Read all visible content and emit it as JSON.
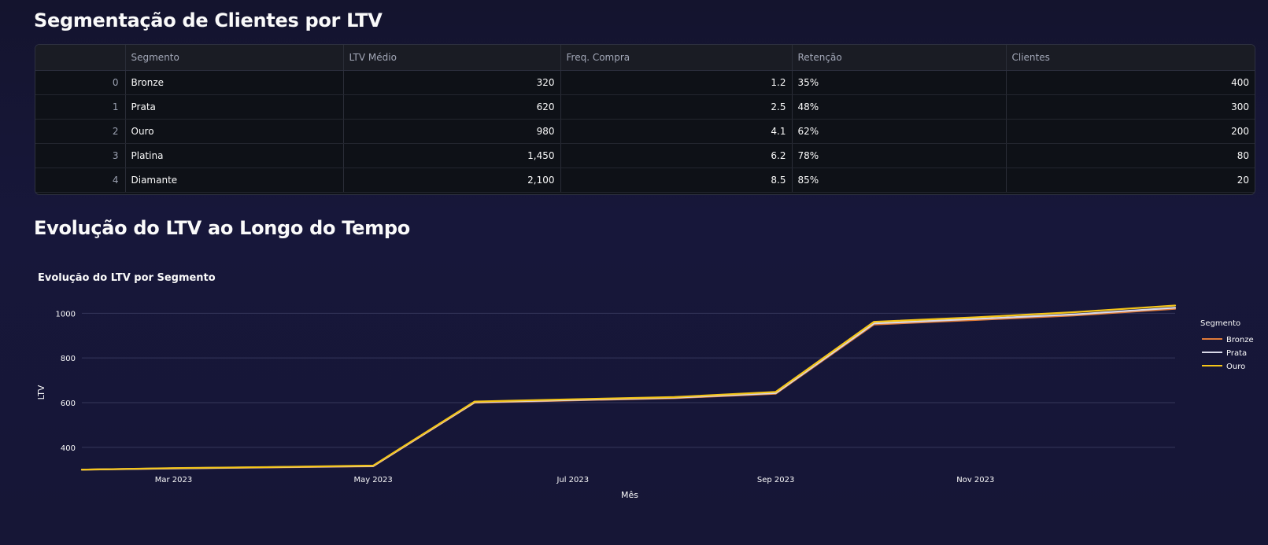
{
  "headings": {
    "segmentation": "Segmentação de Clientes por LTV",
    "evolution": "Evolução do LTV ao Longo do Tempo"
  },
  "table": {
    "columns": [
      "",
      "Segmento",
      "LTV Médio",
      "Freq. Compra",
      "Retenção",
      "Clientes"
    ],
    "rows": [
      [
        "0",
        "Bronze",
        "320",
        "1.2",
        "35%",
        "400"
      ],
      [
        "1",
        "Prata",
        "620",
        "2.5",
        "48%",
        "300"
      ],
      [
        "2",
        "Ouro",
        "980",
        "4.1",
        "62%",
        "200"
      ],
      [
        "3",
        "Platina",
        "1,450",
        "6.2",
        "78%",
        "80"
      ],
      [
        "4",
        "Diamante",
        "2,100",
        "8.5",
        "85%",
        "20"
      ]
    ]
  },
  "chart_data": {
    "type": "line",
    "title": "Evolução do LTV por Segmento",
    "xlabel": "Mês",
    "ylabel": "LTV",
    "x": [
      "2023-02-01",
      "2023-03-01",
      "2023-04-01",
      "2023-05-01",
      "2023-06-01",
      "2023-07-01",
      "2023-08-01",
      "2023-09-01",
      "2023-10-01",
      "2023-11-01",
      "2023-12-01",
      "2024-01-01"
    ],
    "xticks": [
      "Mar 2023",
      "May 2023",
      "Jul 2023",
      "Sep 2023",
      "Nov 2023"
    ],
    "xtick_dates": [
      "2023-03-01",
      "2023-05-01",
      "2023-07-01",
      "2023-09-01",
      "2023-11-01"
    ],
    "yticks": [
      400,
      600,
      800,
      1000
    ],
    "ylim": [
      290,
      1100
    ],
    "grid": true,
    "legend": {
      "title": "Segmento",
      "position": "right"
    },
    "series": [
      {
        "name": "Bronze",
        "color": "#e07b39",
        "values": [
          300,
          305,
          310,
          315,
          600,
          610,
          620,
          640,
          950,
          970,
          990,
          1020
        ]
      },
      {
        "name": "Prata",
        "color": "#d8d8e8",
        "values": [
          300,
          306,
          311,
          316,
          602,
          612,
          622,
          643,
          955,
          975,
          995,
          1025
        ]
      },
      {
        "name": "Ouro",
        "color": "#f5c518",
        "values": [
          300,
          307,
          312,
          318,
          605,
          615,
          625,
          648,
          962,
          982,
          1005,
          1035
        ]
      }
    ]
  }
}
